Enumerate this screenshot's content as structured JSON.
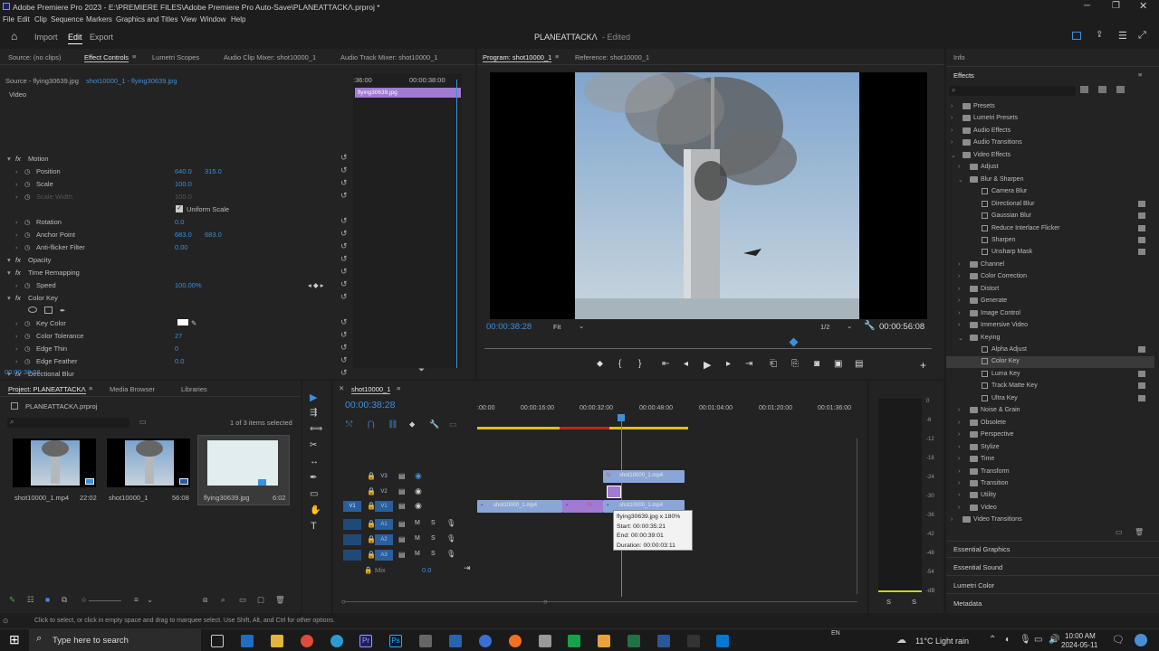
{
  "titlebar": {
    "title": "Adobe Premiere Pro 2023 - E:\\PREMIERE FILES\\Adobe Premiere Pro Auto-Save\\PLANEATTACKΛ.prproj *"
  },
  "menu": [
    "File",
    "Edit",
    "Clip",
    "Sequence",
    "Markers",
    "Graphics and Titles",
    "View",
    "Window",
    "Help"
  ],
  "header": {
    "import": "Import",
    "edit": "Edit",
    "export": "Export",
    "project": "PLANEATTACKΛ",
    "status": "- Edited"
  },
  "source_tabs": {
    "source": "Source: (no clips)",
    "effect_controls": "Effect Controls",
    "lumetri": "Lumetri Scopes",
    "audio_clip_mixer": "Audio Clip Mixer: shot10000_1",
    "audio_track_mixer": "Audio Track Mixer: shot10000_1"
  },
  "ec": {
    "source": "Source - flying30639.jpg",
    "clip": "shot10000_1 - flying30639.jpg",
    "section": "Video",
    "mini_tc1": ":36:00",
    "mini_tc2": "00:00:38:00",
    "mini_clip": "flying30639.jpg",
    "timecode": "00:00:38:28",
    "rows": [
      {
        "label": "Motion",
        "type": "group"
      },
      {
        "label": "Position",
        "v1": "640.0",
        "v2": "315.0"
      },
      {
        "label": "Scale",
        "v1": "100.0"
      },
      {
        "label": "Scale Width",
        "v1": "100.0",
        "disabled": true
      },
      {
        "label": "",
        "check": "Uniform Scale"
      },
      {
        "label": "Rotation",
        "v1": "0.0"
      },
      {
        "label": "Anchor Point",
        "v1": "683.0",
        "v2": "683.0"
      },
      {
        "label": "Anti-flicker Filter",
        "v1": "0.00"
      },
      {
        "label": "Opacity",
        "type": "group"
      },
      {
        "label": "Time Remapping",
        "type": "group"
      },
      {
        "label": "Speed",
        "v1": "100.00%"
      },
      {
        "label": "Color Key",
        "type": "group"
      },
      {
        "label": "",
        "tools": true
      },
      {
        "label": "Key Color",
        "swatch": true
      },
      {
        "label": "Color Tolerance",
        "v1": "27"
      },
      {
        "label": "Edge Thin",
        "v1": "0"
      },
      {
        "label": "Edge Feather",
        "v1": "0.0"
      },
      {
        "label": "Directional Blur",
        "type": "group"
      },
      {
        "label": "",
        "tools": true
      },
      {
        "label": "Direction",
        "v1": "80.0 °"
      },
      {
        "label": "Blur Length",
        "v1": "7.0"
      }
    ]
  },
  "program": {
    "tab": "Program: shot10000_1",
    "ref": "Reference: shot10000_1",
    "timecode": "00:00:38:28",
    "fit": "Fit",
    "res": "1/2",
    "duration": "00:00:56:08"
  },
  "project": {
    "tab": "Project: PLANEATTACKΛ",
    "media": "Media Browser",
    "libraries": "Libraries",
    "file": "PLANEATTACKΛ.prproj",
    "selected": "1 of 3 items selected",
    "items": [
      {
        "name": "shot10000_1.mp4",
        "dur": "22:02"
      },
      {
        "name": "shot10000_1",
        "dur": "56:08"
      },
      {
        "name": "flying30639.jpg",
        "dur": "6:02"
      }
    ]
  },
  "timeline": {
    "tab": "shot10000_1",
    "timecode": "00:00:38:28",
    "ruler": [
      ":00:00",
      "00:00:16:00",
      "00:00:32:00",
      "00:00:48:00",
      "00:01:04:00",
      "00:01:20:00",
      "00:01:36:00"
    ],
    "tracks": [
      {
        "name": "V3"
      },
      {
        "name": "V2"
      },
      {
        "name": "V1"
      },
      {
        "name": "A1"
      },
      {
        "name": "A2"
      },
      {
        "name": "A3"
      }
    ],
    "mix": "Mix",
    "mix_val": "0.0",
    "clip_v3": "shot10000_1.mp4",
    "clip_v1a": "shot10000_1.mp4",
    "clip_v1b": "shot10000_1.mp4",
    "tooltip": {
      "line1": "flying30639.jpg x 180%",
      "line2": "Start: 00:00:35:21",
      "line3": "End: 00:00:39:01",
      "line4": "Duration: 00:00:03:11"
    }
  },
  "meter": {
    "scale": [
      "0",
      "-6",
      "-12",
      "-18",
      "-24",
      "-30",
      "-36",
      "-42",
      "-48",
      "-54",
      "-dB"
    ],
    "s1": "S",
    "s2": "S"
  },
  "effects": {
    "info": "Info",
    "title": "Effects",
    "items": [
      {
        "t": "Presets",
        "lvl": 0,
        "kind": "folder",
        "open": false
      },
      {
        "t": "Lumetri Presets",
        "lvl": 0,
        "kind": "folder",
        "open": false
      },
      {
        "t": "Audio Effects",
        "lvl": 0,
        "kind": "folder",
        "open": false
      },
      {
        "t": "Audio Transitions",
        "lvl": 0,
        "kind": "folder",
        "open": false
      },
      {
        "t": "Video Effects",
        "lvl": 0,
        "kind": "folder",
        "open": true
      },
      {
        "t": "Adjust",
        "lvl": 1,
        "kind": "folder",
        "open": false
      },
      {
        "t": "Blur & Sharpen",
        "lvl": 1,
        "kind": "folder",
        "open": true
      },
      {
        "t": "Camera Blur",
        "lvl": 2,
        "kind": "preset",
        "badge": false
      },
      {
        "t": "Directional Blur",
        "lvl": 2,
        "kind": "preset",
        "badge": true
      },
      {
        "t": "Gaussian Blur",
        "lvl": 2,
        "kind": "preset",
        "badge": true
      },
      {
        "t": "Reduce Interlace Flicker",
        "lvl": 2,
        "kind": "preset",
        "badge": true
      },
      {
        "t": "Sharpen",
        "lvl": 2,
        "kind": "preset",
        "badge": true
      },
      {
        "t": "Unsharp Mask",
        "lvl": 2,
        "kind": "preset",
        "badge": true
      },
      {
        "t": "Channel",
        "lvl": 1,
        "kind": "folder",
        "open": false
      },
      {
        "t": "Color Correction",
        "lvl": 1,
        "kind": "folder",
        "open": false
      },
      {
        "t": "Distort",
        "lvl": 1,
        "kind": "folder",
        "open": false
      },
      {
        "t": "Generate",
        "lvl": 1,
        "kind": "folder",
        "open": false
      },
      {
        "t": "Image Control",
        "lvl": 1,
        "kind": "folder",
        "open": false
      },
      {
        "t": "Immersive Video",
        "lvl": 1,
        "kind": "folder",
        "open": false
      },
      {
        "t": "Keying",
        "lvl": 1,
        "kind": "folder",
        "open": true
      },
      {
        "t": "Alpha Adjust",
        "lvl": 2,
        "kind": "preset",
        "badge": true
      },
      {
        "t": "Color Key",
        "lvl": 2,
        "kind": "preset",
        "badge": false,
        "selected": true
      },
      {
        "t": "Luma Key",
        "lvl": 2,
        "kind": "preset",
        "badge": true
      },
      {
        "t": "Track Matte Key",
        "lvl": 2,
        "kind": "preset",
        "badge": true
      },
      {
        "t": "Ultra Key",
        "lvl": 2,
        "kind": "preset",
        "badge": true
      },
      {
        "t": "Noise & Grain",
        "lvl": 1,
        "kind": "folder",
        "open": false
      },
      {
        "t": "Obsolete",
        "lvl": 1,
        "kind": "folder",
        "open": false
      },
      {
        "t": "Perspective",
        "lvl": 1,
        "kind": "folder",
        "open": false
      },
      {
        "t": "Stylize",
        "lvl": 1,
        "kind": "folder",
        "open": false
      },
      {
        "t": "Time",
        "lvl": 1,
        "kind": "folder",
        "open": false
      },
      {
        "t": "Transform",
        "lvl": 1,
        "kind": "folder",
        "open": false
      },
      {
        "t": "Transition",
        "lvl": 1,
        "kind": "folder",
        "open": false
      },
      {
        "t": "Utility",
        "lvl": 1,
        "kind": "folder",
        "open": false
      },
      {
        "t": "Video",
        "lvl": 1,
        "kind": "folder",
        "open": false
      },
      {
        "t": "Video Transitions",
        "lvl": 0,
        "kind": "folder",
        "open": false
      }
    ],
    "essential_graphics": "Essential Graphics",
    "essential_sound": "Essential Sound",
    "lumetri_color": "Lumetri Color",
    "metadata": "Metadata"
  },
  "status": "Click to select, or click in empty space and drag to marquee select. Use Shift, Alt, and Ctrl for other options.",
  "taskbar": {
    "search": "Type here to search",
    "weather": "11°C  Light rain",
    "lang": "EN",
    "time": "10:00 AM",
    "date": "2024-05-11"
  }
}
